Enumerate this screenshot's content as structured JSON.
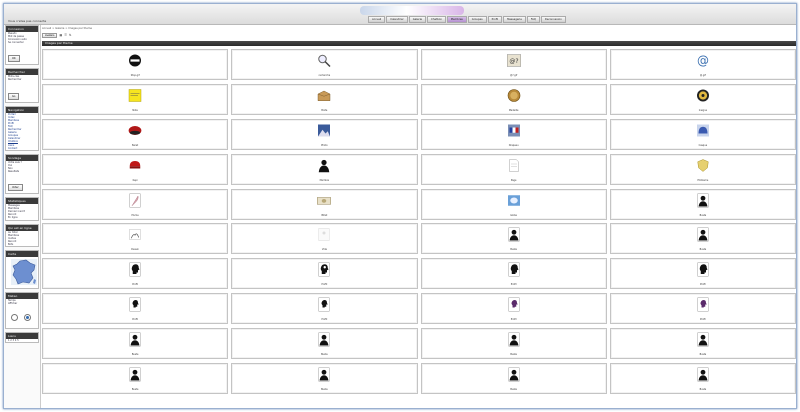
{
  "site": {
    "login_text": "Vous n'etes pas connecte"
  },
  "nav": {
    "tabs": [
      "Accueil",
      "Calendrier",
      "Galerie",
      "Chatbox",
      "Membres",
      "Groupes",
      "Profil",
      "Messagerie",
      "FAQ",
      "Deconnexion"
    ],
    "active_index": 4
  },
  "main": {
    "breadcrumb": "Accueil > Galerie > Images par theme",
    "toolbar_button": "Avatars",
    "gallery_title": "Images par theme"
  },
  "sidebar": {
    "box1": {
      "title": "Connexion",
      "lines": [
        "Pseudo",
        "Mot de passe",
        "Connexion auto",
        "Se connecter"
      ],
      "button": "OK"
    },
    "box2": {
      "title": "Rechercher",
      "lines": [
        "Mots-cles",
        "Rechercher"
      ],
      "button": "Go"
    },
    "box3": {
      "title": "Navigation",
      "lines": [
        "Portail",
        "Index",
        "Membres",
        "Profil",
        "FAQ",
        "Rechercher",
        "Galerie",
        "Groupes",
        "Calendrier",
        "Chatbox",
        "Liens",
        "Contact"
      ]
    },
    "box4": {
      "title": "Sondage",
      "lines": [
        "Votre avis ?",
        "Oui",
        "Non",
        "Resultats"
      ],
      "button": "Voter"
    },
    "box5": {
      "title": "Statistiques",
      "lines": [
        "Messages",
        "Membres",
        "Dernier inscrit",
        "Record",
        "En ligne"
      ]
    },
    "box6": {
      "title": "Qui est en ligne",
      "lines": [
        "Au total",
        "Membres",
        "Invites",
        "Record",
        "Bots"
      ]
    },
    "box7": {
      "title": "Carte"
    },
    "box8": {
      "title": "Meteo",
      "lines": [
        "Temps",
        "Afficher"
      ]
    },
    "box9": {
      "title": "Liens",
      "lines": [
        "1 2 3 4 5"
      ]
    }
  },
  "gallery": {
    "items": [
      {
        "icon": "round-stop-icon",
        "caption": "Stop.gif"
      },
      {
        "icon": "magnifier-icon",
        "caption": "recherche"
      },
      {
        "icon": "at-question-icon",
        "caption": "@?.gif"
      },
      {
        "icon": "at-sign-icon",
        "caption": "@.gif"
      },
      {
        "icon": "yellow-note-icon",
        "caption": "Note"
      },
      {
        "icon": "open-box-icon",
        "caption": "Boite"
      },
      {
        "icon": "gold-medal-icon",
        "caption": "Medaille"
      },
      {
        "icon": "gold-badge-icon",
        "caption": "Insigne"
      },
      {
        "icon": "red-beret-icon",
        "caption": "Beret"
      },
      {
        "icon": "photo-blue-icon",
        "caption": "Photo"
      },
      {
        "icon": "flag-photo-icon",
        "caption": "Drapeau"
      },
      {
        "icon": "helmet-icon",
        "caption": "Casque"
      },
      {
        "icon": "red-cap-icon",
        "caption": "Kepi"
      },
      {
        "icon": "silhouette-icon",
        "caption": "Membre"
      },
      {
        "icon": "paper-sheet-icon",
        "caption": "Page"
      },
      {
        "icon": "emblem-icon",
        "caption": "Embleme"
      },
      {
        "icon": "feather-pen-icon",
        "caption": "Plume"
      },
      {
        "icon": "banknote-icon",
        "caption": "Billet"
      },
      {
        "icon": "globe-photo-icon",
        "caption": "Globe"
      },
      {
        "icon": "bust-icon",
        "caption": "Buste"
      },
      {
        "icon": "drawing-icon",
        "caption": "Dessin"
      },
      {
        "icon": "blank-sheet-icon",
        "caption": "Vide"
      },
      {
        "icon": "bust-icon",
        "caption": "Buste"
      },
      {
        "icon": "bust-icon",
        "caption": "Buste"
      },
      {
        "icon": "head-profile-icon",
        "caption": "Profil"
      },
      {
        "icon": "eye-profile-icon",
        "caption": "Profil"
      },
      {
        "icon": "head-profile-icon",
        "caption": "Profil"
      },
      {
        "icon": "head-profile-icon",
        "caption": "Profil"
      },
      {
        "icon": "head-small-icon",
        "caption": "Profil"
      },
      {
        "icon": "head-small-icon",
        "caption": "Profil"
      },
      {
        "icon": "head-purple-icon",
        "caption": "Profil"
      },
      {
        "icon": "head-purple-icon",
        "caption": "Profil"
      },
      {
        "icon": "bust-icon",
        "caption": "Buste"
      },
      {
        "icon": "bust-icon",
        "caption": "Buste"
      },
      {
        "icon": "bust-icon",
        "caption": "Buste"
      },
      {
        "icon": "bust-icon",
        "caption": "Buste"
      },
      {
        "icon": "bust-icon",
        "caption": "Buste"
      },
      {
        "icon": "bust-icon",
        "caption": "Buste"
      },
      {
        "icon": "bust-icon",
        "caption": "Buste"
      },
      {
        "icon": "bust-icon",
        "caption": "Buste"
      }
    ]
  }
}
